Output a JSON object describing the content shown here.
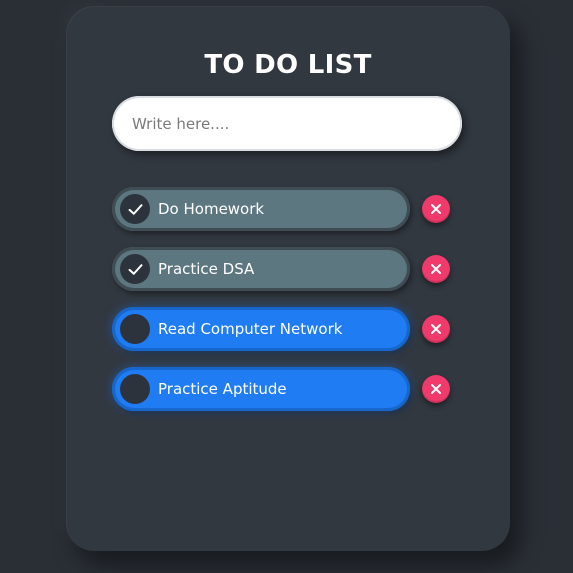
{
  "app": {
    "title": "TO DO LIST"
  },
  "input": {
    "placeholder": "Write here....",
    "value": ""
  },
  "tasks": [
    {
      "text": "Do Homework",
      "completed": true
    },
    {
      "text": "Practice DSA",
      "completed": true
    },
    {
      "text": "Read Computer Network",
      "completed": false
    },
    {
      "text": "Practice Aptitude",
      "completed": false
    }
  ],
  "icons": {
    "check": "check-icon",
    "delete": "close-icon"
  },
  "colors": {
    "background": "#2a2f36",
    "card": "#323840",
    "completed": "#5d7781",
    "open": "#1f7cf2",
    "delete": "#ef3a6b"
  }
}
